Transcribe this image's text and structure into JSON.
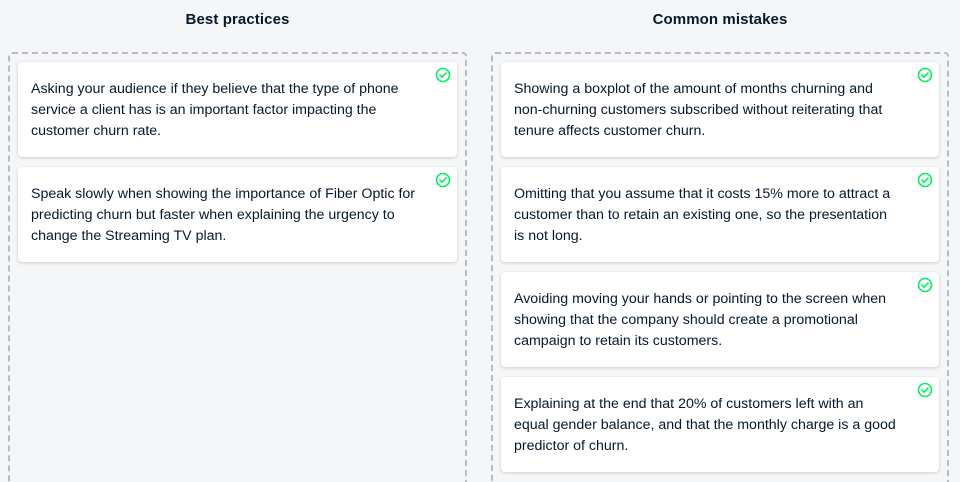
{
  "columns": {
    "best": {
      "title": "Best practices",
      "cards": [
        "Asking your audience if they believe that the type of phone service a client has is an important factor impacting the customer churn rate.",
        "Speak slowly when showing the importance of Fiber Optic for predicting churn but faster when explaining the urgency to change the Streaming TV plan."
      ]
    },
    "mistakes": {
      "title": "Common mistakes",
      "cards": [
        "Showing a boxplot of the amount of months churning and non-churning customers subscribed without reiterating that tenure affects customer churn.",
        "Omitting that you assume that it costs 15% more to attract a customer than to retain an existing one, so the presentation is not long.",
        "Avoiding moving your hands or pointing to the screen when showing that the company should create a promotional campaign to retain its customers.",
        "Explaining at the end that 20% of customers left with an equal gender balance, and that the monthly charge is a good predictor of churn."
      ]
    }
  },
  "icons": {
    "card_status": "check-circle-icon"
  },
  "colors": {
    "check": "#03ef62",
    "text": "#05192d"
  }
}
